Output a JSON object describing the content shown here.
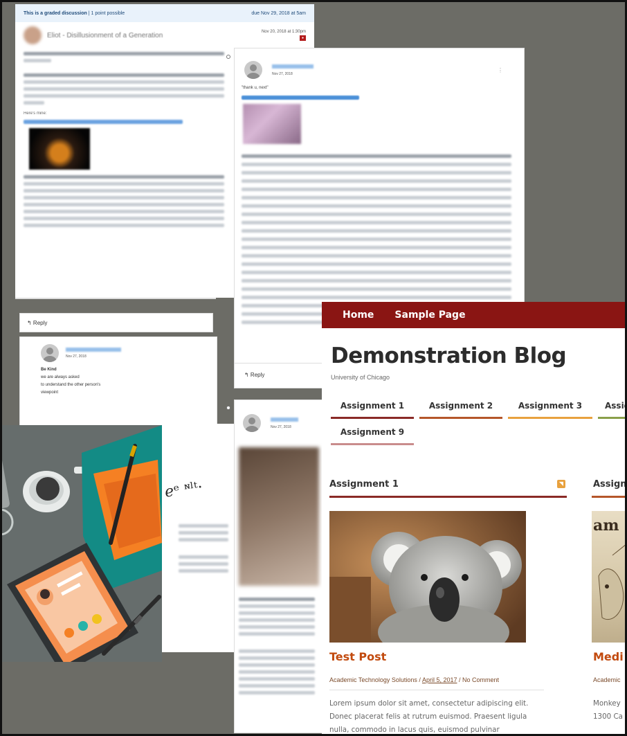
{
  "discussion": {
    "graded_label": "This is a graded discussion",
    "points": "1 point possible",
    "due": "due Nov 29, 2018 at 5am",
    "title": "Eliot - Disillusionment of a Generation",
    "date": "Nov 20, 2018 at 1:30pm",
    "heres_mine": "Here's mine:",
    "reply_label": "↰ Reply"
  },
  "comment_small": {
    "date": "Nov 27, 2018",
    "lines": [
      "Be Kind",
      "we are always asked",
      "to understand the other person's",
      "viewpoint"
    ]
  },
  "comment_big": {
    "date": "Nov 27, 2018",
    "thanks": "\"thank u, next\"",
    "reply_label": "↰ Reply"
  },
  "comment_lower": {
    "date": "Nov 27, 2018"
  },
  "blog": {
    "nav": [
      "Home",
      "Sample Page"
    ],
    "site_title": "Demonstration Blog",
    "site_subtitle": "University of Chicago",
    "tabs": [
      "Assignment 1",
      "Assignment 2",
      "Assignment 3",
      "Assig",
      "Assignment 9"
    ],
    "col1_heading": "Assignment 1",
    "col2_heading": "Assign",
    "post_title": "Test Post",
    "post_author": "Academic Technology Solutions",
    "post_date": "April 5, 2017",
    "post_comments": "No Comment",
    "post_body": "Lorem ipsum dolor sit amet, consectetur adipiscing elit. Donec placerat felis at rutrum euismod. Praesent ligula nulla, commodo in lacus quis, euismod pulvinar",
    "col2_title": "Medi",
    "col2_meta": "Academic",
    "col2_body_1": "Monkey",
    "col2_body_2": "1300 Ca",
    "col2_img_text": "am",
    "colors": {
      "nav_bg": "#8a1513",
      "title": "#c24a0e",
      "tab1": "#8a2a26",
      "tab2": "#b5562a",
      "tab3": "#e8a13e",
      "tab4": "#8aa04a",
      "tab9": "#c98c8c"
    }
  }
}
